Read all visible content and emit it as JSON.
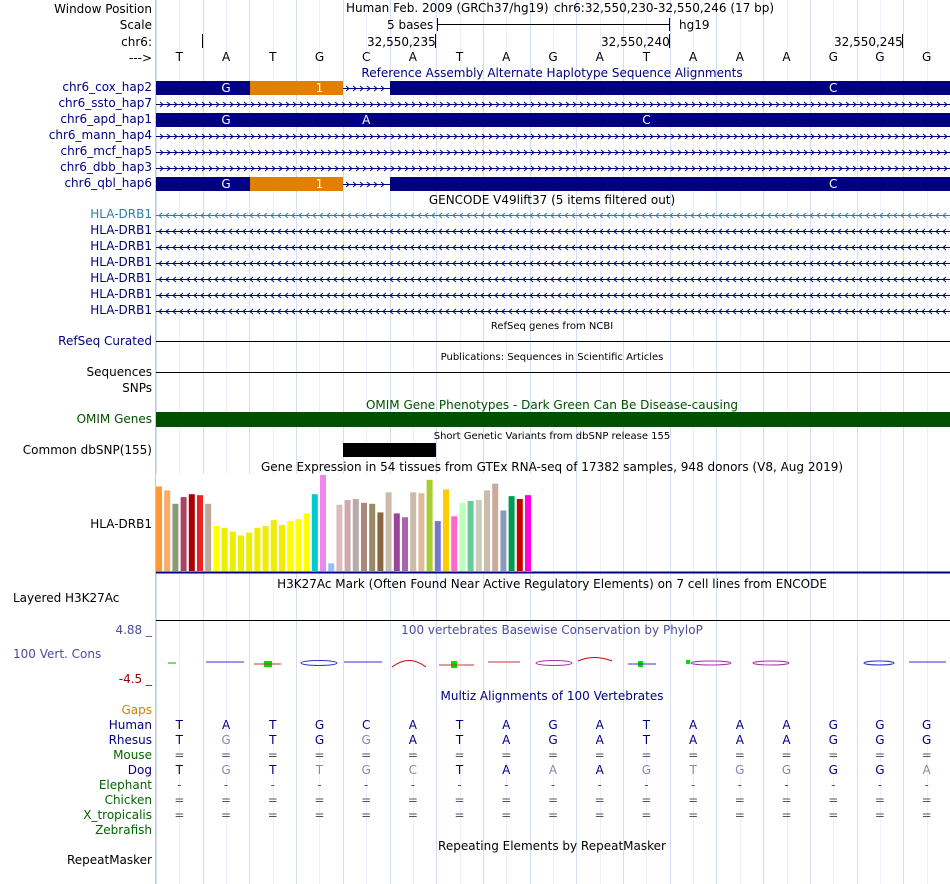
{
  "colors": {
    "navy": "#000080",
    "orange": "#e08000",
    "omim_green": "#005000",
    "gencode_blue": "#2b7fa6",
    "cons_purple": "#4c4c9c",
    "cons_red": "#a00000",
    "gaps_orange": "#d88000",
    "species_green": "#006400",
    "grid_line": "#d6dcf4",
    "divider": "#f2b8b8"
  },
  "header": {
    "window_position_label": "Window Position",
    "assembly": "Human Feb. 2009 (GRCh37/hg19)",
    "position": "chr6:32,550,230-32,550,246 (17 bp)",
    "scale_label": "Scale",
    "scale_text": "5 bases",
    "scale_db": "hg19",
    "chrom_label": "chr6:",
    "arrow_label": "--->",
    "coord_labels": [
      "32,550,235",
      "32,550,240",
      "32,550,245"
    ],
    "bases": [
      "T",
      "A",
      "T",
      "G",
      "C",
      "A",
      "T",
      "A",
      "G",
      "A",
      "T",
      "A",
      "A",
      "A",
      "G",
      "G",
      "G"
    ]
  },
  "alt_haplotypes": {
    "title": "Reference Assembly Alternate Haplotype Sequence Alignments",
    "rows": [
      {
        "label": "chr6_cox_hap2",
        "type": "split",
        "marks": [
          {
            "pos": 1,
            "text": "G"
          },
          {
            "pos": 3,
            "text": "1"
          },
          {
            "pos": 14,
            "text": "C"
          }
        ]
      },
      {
        "label": "chr6_ssto_hap7",
        "type": "line",
        "marks": []
      },
      {
        "label": "chr6_apd_hap1",
        "type": "full",
        "marks": [
          {
            "pos": 1,
            "text": "G"
          },
          {
            "pos": 4,
            "text": "A"
          },
          {
            "pos": 10,
            "text": "C"
          }
        ]
      },
      {
        "label": "chr6_mann_hap4",
        "type": "line",
        "marks": []
      },
      {
        "label": "chr6_mcf_hap5",
        "type": "line",
        "marks": []
      },
      {
        "label": "chr6_dbb_hap3",
        "type": "line",
        "marks": []
      },
      {
        "label": "chr6_qbl_hap6",
        "type": "split",
        "marks": [
          {
            "pos": 1,
            "text": "G"
          },
          {
            "pos": 3,
            "text": "1"
          },
          {
            "pos": 14,
            "text": "C"
          }
        ]
      }
    ]
  },
  "gencode": {
    "title": "GENCODE V49lift37 (5 items filtered out)",
    "items": [
      "HLA-DRB1",
      "HLA-DRB1",
      "HLA-DRB1",
      "HLA-DRB1",
      "HLA-DRB1",
      "HLA-DRB1",
      "HLA-DRB1"
    ]
  },
  "refseq": {
    "title": "RefSeq genes from NCBI",
    "label": "RefSeq Curated"
  },
  "publications": {
    "title": "Publications: Sequences in Scientific Articles",
    "label": "Sequences"
  },
  "snps_label": "SNPs",
  "omim": {
    "title": "OMIM Gene Phenotypes - Dark Green Can Be Disease-causing",
    "label": "OMIM Genes"
  },
  "dbsnp": {
    "title": "Short Genetic Variants from dbSNP release 155",
    "label": "Common dbSNP(155)"
  },
  "gtex": {
    "title": "Gene Expression in 54 tissues from GTEx RNA-seq of 17382 samples, 948 donors (V8, Aug 2019)",
    "label": "HLA-DRB1",
    "bars": [
      {
        "v": 0.88,
        "c": "#ff9933"
      },
      {
        "v": 0.84,
        "c": "#ffaa66"
      },
      {
        "v": 0.7,
        "c": "#889977"
      },
      {
        "v": 0.77,
        "c": "#aa4466"
      },
      {
        "v": 0.8,
        "c": "#aa0000"
      },
      {
        "v": 0.79,
        "c": "#ee2222"
      },
      {
        "v": 0.7,
        "c": "#bbaa99"
      },
      {
        "v": 0.47,
        "c": "#ffff00"
      },
      {
        "v": 0.45,
        "c": "#eeee00"
      },
      {
        "v": 0.41,
        "c": "#eeee00"
      },
      {
        "v": 0.37,
        "c": "#eeee00"
      },
      {
        "v": 0.4,
        "c": "#eeee00"
      },
      {
        "v": 0.45,
        "c": "#eeee00"
      },
      {
        "v": 0.47,
        "c": "#eeee00"
      },
      {
        "v": 0.53,
        "c": "#eeee00"
      },
      {
        "v": 0.48,
        "c": "#eeee00"
      },
      {
        "v": 0.52,
        "c": "#ffff00"
      },
      {
        "v": 0.54,
        "c": "#ffff00"
      },
      {
        "v": 0.6,
        "c": "#ffff00"
      },
      {
        "v": 0.8,
        "c": "#00cccc"
      },
      {
        "v": 1.0,
        "c": "#ee88ee"
      },
      {
        "v": 0.08,
        "c": "#99bbff"
      },
      {
        "v": 0.69,
        "c": "#ddbbbb"
      },
      {
        "v": 0.74,
        "c": "#ccaaaa"
      },
      {
        "v": 0.75,
        "c": "#bbaaaa"
      },
      {
        "v": 0.71,
        "c": "#aa8877"
      },
      {
        "v": 0.7,
        "c": "#998866"
      },
      {
        "v": 0.61,
        "c": "#886644"
      },
      {
        "v": 0.82,
        "c": "#ccbbaa"
      },
      {
        "v": 0.6,
        "c": "#994499"
      },
      {
        "v": 0.56,
        "c": "#aa66aa"
      },
      {
        "v": 0.82,
        "c": "#ccbbaa"
      },
      {
        "v": 0.81,
        "c": "#ddbb99"
      },
      {
        "v": 0.95,
        "c": "#aacc33"
      },
      {
        "v": 0.52,
        "c": "#7777cc"
      },
      {
        "v": 0.85,
        "c": "#ffcc00"
      },
      {
        "v": 0.57,
        "c": "#ff66cc"
      },
      {
        "v": 0.71,
        "c": "#bbffbb"
      },
      {
        "v": 0.73,
        "c": "#66cc99"
      },
      {
        "v": 0.74,
        "c": "#ccccbb"
      },
      {
        "v": 0.84,
        "c": "#ccbbaa"
      },
      {
        "v": 0.91,
        "c": "#ccaa99"
      },
      {
        "v": 0.63,
        "c": "#8899bb"
      },
      {
        "v": 0.78,
        "c": "#009955"
      },
      {
        "v": 0.75,
        "c": "#cc0000"
      },
      {
        "v": 0.79,
        "c": "#ff00dd"
      }
    ]
  },
  "h3k27ac": {
    "title": "H3K27Ac Mark (Often Found Near Active Regulatory Elements) on 7 cell lines from ENCODE",
    "label": "Layered H3K27Ac"
  },
  "cons": {
    "title": "100 vertebrates Basewise Conservation by PhyloP",
    "label": "100 Vert. Cons",
    "max": "4.88 _",
    "min": "-4.5 _"
  },
  "multiz": {
    "title": "Multiz Alignments of 100 Vertebrates",
    "gaps_label": "Gaps",
    "species": [
      {
        "name": "Human",
        "color": "#000080",
        "seq": [
          "T",
          "A",
          "T",
          "G",
          "C",
          "A",
          "T",
          "A",
          "G",
          "A",
          "T",
          "A",
          "A",
          "A",
          "G",
          "G",
          "G"
        ]
      },
      {
        "name": "Rhesus",
        "color": "#000080",
        "seq": [
          "T",
          "G",
          "T",
          "G",
          "G",
          "A",
          "T",
          "A",
          "G",
          "A",
          "T",
          "A",
          "A",
          "A",
          "G",
          "G",
          "G"
        ]
      },
      {
        "name": "Mouse",
        "color": "#006400",
        "seq": [
          "=",
          "=",
          "=",
          "=",
          "=",
          "=",
          "=",
          "=",
          "=",
          "=",
          "=",
          "=",
          "=",
          "=",
          "=",
          "=",
          "="
        ]
      },
      {
        "name": "Dog",
        "color": "#000080",
        "seq": [
          "T",
          "G",
          "T",
          "T",
          "G",
          "C",
          "T",
          "A",
          "A",
          "A",
          "G",
          "T",
          "G",
          "G",
          "G",
          "G",
          "A"
        ]
      },
      {
        "name": "Elephant",
        "color": "#006400",
        "seq": [
          "-",
          "-",
          "-",
          "-",
          "-",
          "-",
          "-",
          "-",
          "-",
          "-",
          "-",
          "-",
          "-",
          "-",
          "-",
          "-",
          "-"
        ]
      },
      {
        "name": "Chicken",
        "color": "#006400",
        "seq": [
          "=",
          "=",
          "=",
          "=",
          "=",
          "=",
          "=",
          "=",
          "=",
          "=",
          "=",
          "=",
          "=",
          "=",
          "=",
          "=",
          "="
        ]
      },
      {
        "name": "X_tropicalis",
        "color": "#006400",
        "seq": [
          "=",
          "=",
          "=",
          "=",
          "=",
          "=",
          "=",
          "=",
          "=",
          "=",
          "=",
          "=",
          "=",
          "=",
          "=",
          "=",
          "="
        ]
      },
      {
        "name": "Zebrafish",
        "color": "#006400",
        "seq": []
      }
    ]
  },
  "repeatmasker": {
    "title": "Repeating Elements by RepeatMasker",
    "label": "RepeatMasker"
  }
}
